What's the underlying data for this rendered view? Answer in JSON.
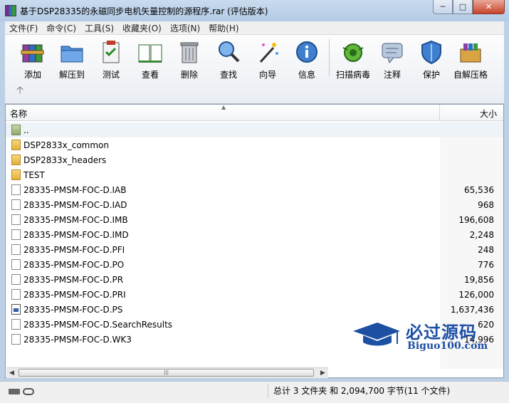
{
  "window": {
    "title": "基于DSP28335的永磁同步电机矢量控制的源程序.rar (评估版本)"
  },
  "menu": [
    "文件(F)",
    "命令(C)",
    "工具(S)",
    "收藏夹(O)",
    "选项(N)",
    "帮助(H)"
  ],
  "toolbar": {
    "add": "添加",
    "extract_to": "解压到",
    "test": "测试",
    "view": "查看",
    "delete": "删除",
    "find": "查找",
    "wizard": "向导",
    "info": "信息",
    "virus_scan": "扫描病毒",
    "comment": "注释",
    "protect": "保护",
    "sfx": "自解压格"
  },
  "columns": {
    "name": "名称",
    "size": "大小"
  },
  "files": [
    {
      "name": "..",
      "size": "",
      "type": "up"
    },
    {
      "name": "DSP2833x_common",
      "size": "",
      "type": "folder"
    },
    {
      "name": "DSP2833x_headers",
      "size": "",
      "type": "folder"
    },
    {
      "name": "TEST",
      "size": "",
      "type": "folder"
    },
    {
      "name": "28335-PMSM-FOC-D.IAB",
      "size": "65,536",
      "type": "file"
    },
    {
      "name": "28335-PMSM-FOC-D.IAD",
      "size": "968",
      "type": "file"
    },
    {
      "name": "28335-PMSM-FOC-D.IMB",
      "size": "196,608",
      "type": "file"
    },
    {
      "name": "28335-PMSM-FOC-D.IMD",
      "size": "2,248",
      "type": "file"
    },
    {
      "name": "28335-PMSM-FOC-D.PFI",
      "size": "248",
      "type": "file"
    },
    {
      "name": "28335-PMSM-FOC-D.PO",
      "size": "776",
      "type": "file"
    },
    {
      "name": "28335-PMSM-FOC-D.PR",
      "size": "19,856",
      "type": "file"
    },
    {
      "name": "28335-PMSM-FOC-D.PRI",
      "size": "126,000",
      "type": "file"
    },
    {
      "name": "28335-PMSM-FOC-D.PS",
      "size": "1,637,436",
      "type": "ps"
    },
    {
      "name": "28335-PMSM-FOC-D.SearchResults",
      "size": "620",
      "type": "file"
    },
    {
      "name": "28335-PMSM-FOC-D.WK3",
      "size": "14,996",
      "type": "file"
    }
  ],
  "status": {
    "summary": "总计 3 文件夹 和 2,094,700 字节(11 个文件)"
  },
  "watermark": {
    "cn": "必过源码",
    "en": "Biguo100.com"
  },
  "colors": {
    "folder": "#e9bb4a",
    "accent": "#1d4fa3"
  }
}
